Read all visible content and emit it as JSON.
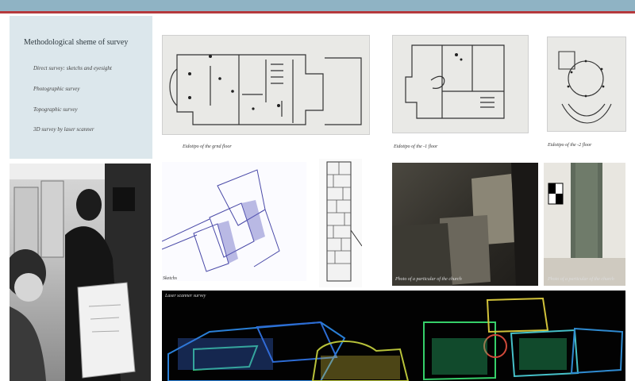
{
  "survey_panel": {
    "title": "Methodological sheme of survey",
    "methods": [
      "Direct survey: sketchs and eyesight",
      "Photographic survey",
      "Topographic survey",
      "3D survey by laser scanner"
    ]
  },
  "plans": [
    {
      "caption": "Eidotipo of the grnd floor"
    },
    {
      "caption": "Eidotipo of the -1 floor"
    },
    {
      "caption": "Eidotipo of the -2 floor"
    }
  ],
  "sketch_caption": "Sketchs",
  "photo_captions": [
    "Photo of a particular of the church",
    "Photo of a particular of the church"
  ],
  "laser_caption": "Laser scanner survey",
  "colors": {
    "header_bar": "#8fb3c4",
    "header_line": "#b5393c",
    "panel_bg": "#dce7ec"
  }
}
